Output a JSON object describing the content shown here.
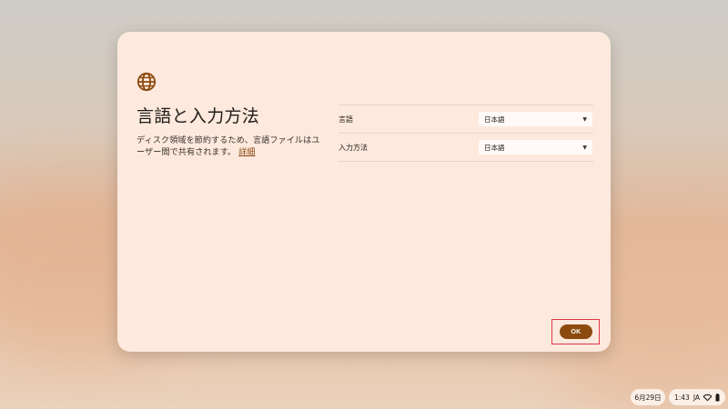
{
  "dialog": {
    "title": "言語と入力方法",
    "description": "ディスク領域を節約するため、言語ファイルはユーザー間で共有されます。",
    "learn_more": "詳細",
    "rows": [
      {
        "label": "言語",
        "value": "日本語"
      },
      {
        "label": "入力方法",
        "value": "日本語"
      }
    ],
    "ok_label": "OK"
  },
  "shelf": {
    "date": "6月29日",
    "time": "1:43",
    "ime": "JA"
  },
  "colors": {
    "accent": "#8c4a0f",
    "dialog_bg": "#fde9dd",
    "focus_ring": "#e0344a"
  },
  "icons": [
    "globe-icon",
    "chevron-down-icon",
    "network-icon",
    "battery-icon"
  ]
}
